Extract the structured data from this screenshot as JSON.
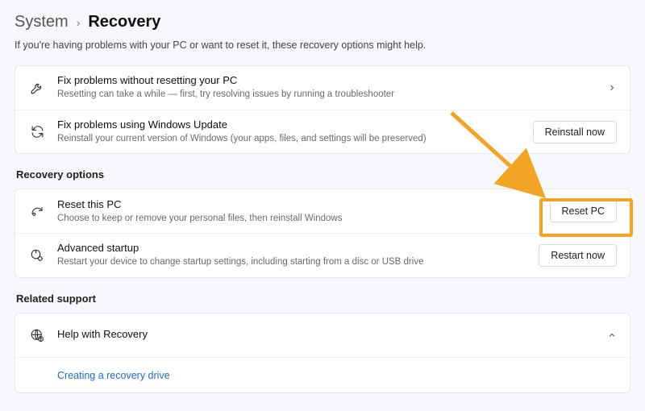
{
  "breadcrumb": {
    "parent": "System",
    "current": "Recovery"
  },
  "subhead": "If you're having problems with your PC or want to reset it, these recovery options might help.",
  "cards1": {
    "fix": {
      "title": "Fix problems without resetting your PC",
      "desc": "Resetting can take a while — first, try resolving issues by running a troubleshooter"
    },
    "update": {
      "title": "Fix problems using Windows Update",
      "desc": "Reinstall your current version of Windows (your apps, files, and settings will be preserved)",
      "button": "Reinstall now"
    }
  },
  "recovery": {
    "section_label": "Recovery options",
    "reset": {
      "title": "Reset this PC",
      "desc": "Choose to keep or remove your personal files, then reinstall Windows",
      "button": "Reset PC"
    },
    "advanced": {
      "title": "Advanced startup",
      "desc": "Restart your device to change startup settings, including starting from a disc or USB drive",
      "button": "Restart now"
    }
  },
  "support": {
    "section_label": "Related support",
    "help_title": "Help with Recovery",
    "link": "Creating a recovery drive"
  },
  "annotation": {
    "arrow_color": "#f2a525"
  }
}
